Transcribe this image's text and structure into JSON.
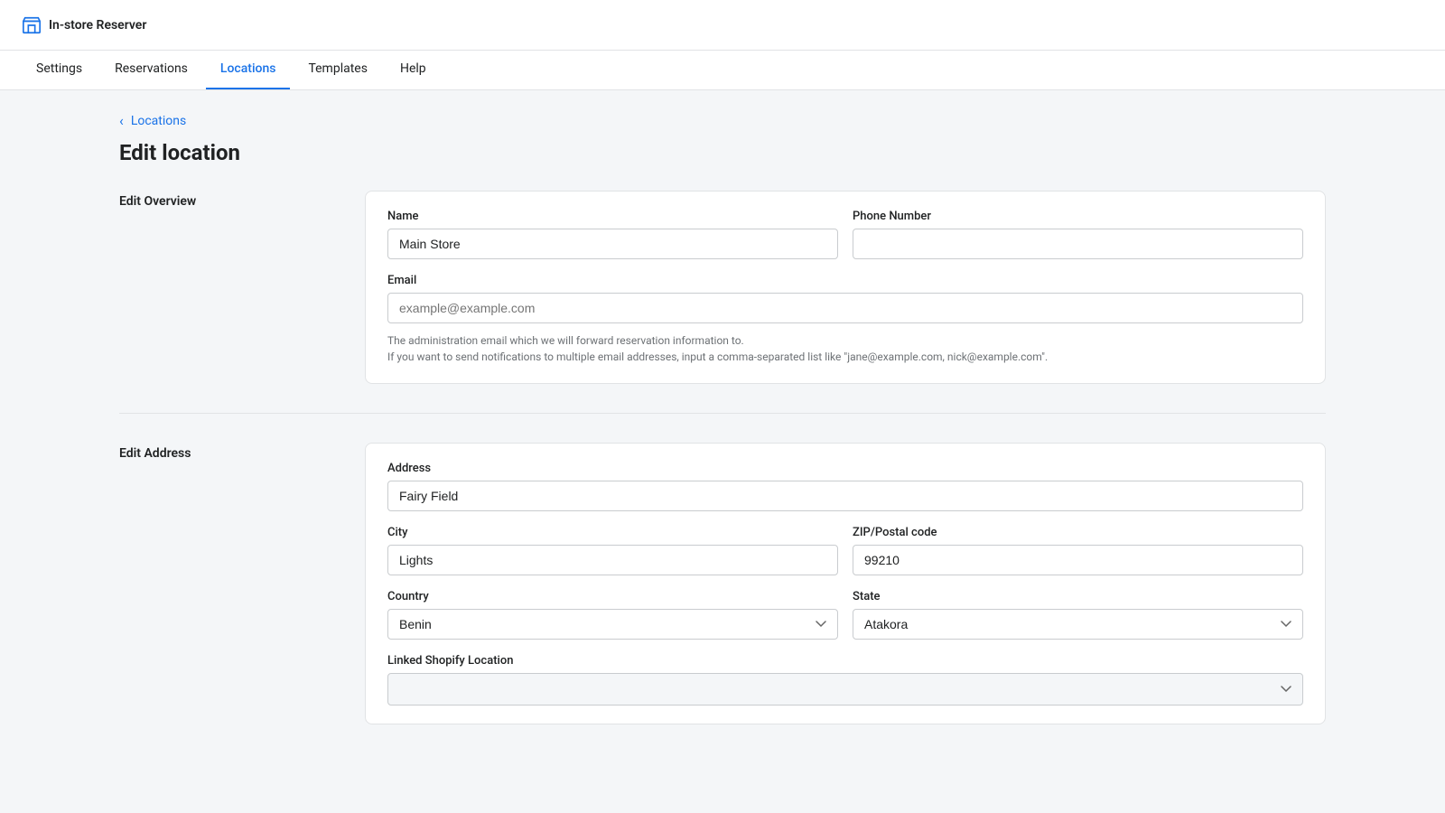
{
  "app": {
    "name": "In-store Reserver",
    "logo_icon": "store"
  },
  "nav": {
    "items": [
      {
        "label": "Settings",
        "active": false
      },
      {
        "label": "Reservations",
        "active": false
      },
      {
        "label": "Locations",
        "active": true
      },
      {
        "label": "Templates",
        "active": false
      },
      {
        "label": "Help",
        "active": false
      }
    ]
  },
  "breadcrumb": {
    "label": "Locations",
    "chevron": "‹"
  },
  "page": {
    "title": "Edit location"
  },
  "edit_overview": {
    "section_label": "Edit Overview",
    "name_label": "Name",
    "name_value": "Main Store",
    "phone_label": "Phone Number",
    "phone_value": "",
    "email_label": "Email",
    "email_placeholder": "example@example.com",
    "email_hint_1": "The administration email which we will forward reservation information to.",
    "email_hint_2": "If you want to send notifications to multiple email addresses, input a comma-separated list like \"jane@example.com, nick@example.com\"."
  },
  "edit_address": {
    "section_label": "Edit Address",
    "address_label": "Address",
    "address_value": "Fairy Field",
    "city_label": "City",
    "city_value": "Lights",
    "zip_label": "ZIP/Postal code",
    "zip_value": "99210",
    "country_label": "Country",
    "country_value": "Benin",
    "state_label": "State",
    "state_value": "Atakora",
    "linked_shopify_label": "Linked Shopify Location",
    "linked_shopify_value": "",
    "country_options": [
      "Benin"
    ],
    "state_options": [
      "Atakora"
    ]
  }
}
